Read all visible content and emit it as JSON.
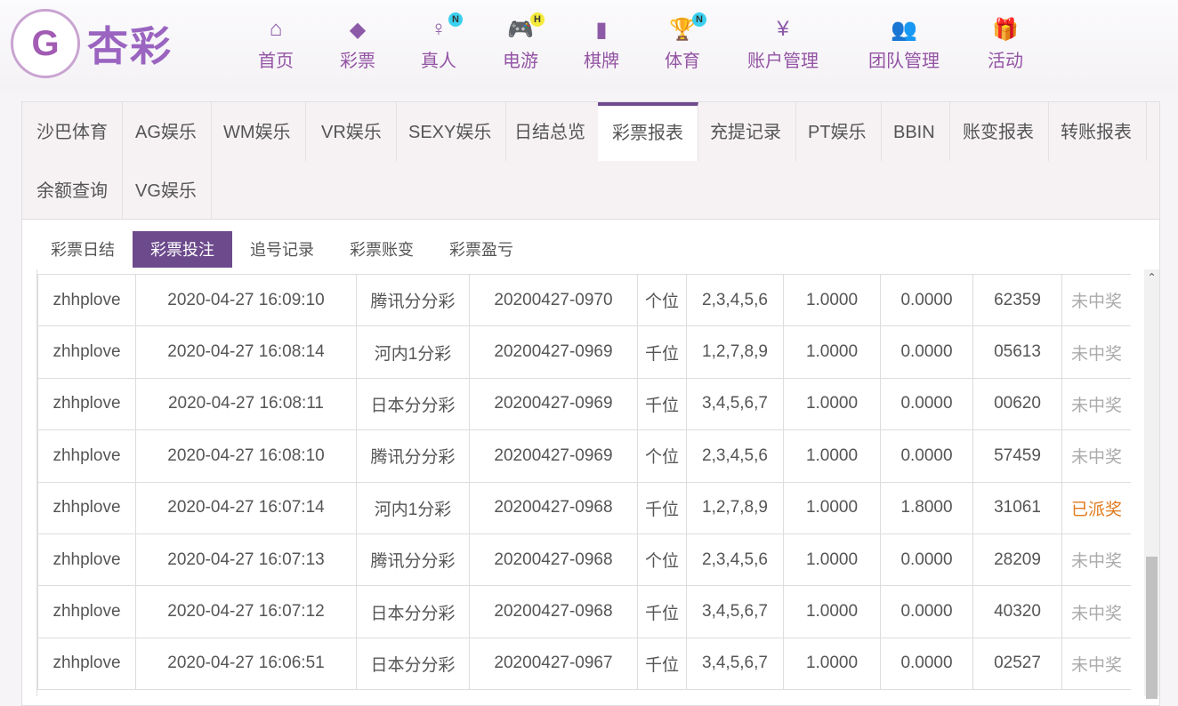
{
  "brand": {
    "name": "杏彩",
    "mark": "G"
  },
  "nav": [
    {
      "label": "首页",
      "icon": "home-icon",
      "glyph": "⌂"
    },
    {
      "label": "彩票",
      "icon": "ticket-icon",
      "glyph": "◆"
    },
    {
      "label": "真人",
      "icon": "live-dealer-icon",
      "glyph": "♀",
      "badge": "N",
      "badge_color": "#3ad0f0"
    },
    {
      "label": "电游",
      "icon": "gamepad-icon",
      "glyph": "🎮",
      "badge": "H",
      "badge_color": "#f4ea3a"
    },
    {
      "label": "棋牌",
      "icon": "cards-icon",
      "glyph": "▮"
    },
    {
      "label": "体育",
      "icon": "trophy-icon",
      "glyph": "🏆",
      "badge": "N",
      "badge_color": "#3ad0f0"
    },
    {
      "label": "账户管理",
      "icon": "yen-coin-icon",
      "glyph": "¥"
    },
    {
      "label": "团队管理",
      "icon": "team-icon",
      "glyph": "👥"
    },
    {
      "label": "活动",
      "icon": "gift-icon",
      "glyph": "🎁"
    }
  ],
  "tabs": [
    "沙巴体育",
    "AG娱乐",
    "WM娱乐",
    "VR娱乐",
    "SEXY娱乐",
    "日结总览",
    "彩票报表",
    "充提记录",
    "PT娱乐",
    "BBIN",
    "账变报表",
    "转账报表",
    "余额查询",
    "VG娱乐"
  ],
  "active_tab": "彩票报表",
  "subtabs": [
    "彩票日结",
    "彩票投注",
    "追号记录",
    "彩票账变",
    "彩票盈亏"
  ],
  "active_subtab": "彩票投注",
  "rows": [
    [
      "zhhplove",
      "2020-04-27 16:09:10",
      "腾讯分分彩",
      "20200427-0970",
      "个位",
      "2,3,4,5,6",
      "1.0000",
      "0.0000",
      "62359",
      "未中奖"
    ],
    [
      "zhhplove",
      "2020-04-27 16:08:14",
      "河内1分彩",
      "20200427-0969",
      "千位",
      "1,2,7,8,9",
      "1.0000",
      "0.0000",
      "05613",
      "未中奖"
    ],
    [
      "zhhplove",
      "2020-04-27 16:08:11",
      "日本分分彩",
      "20200427-0969",
      "千位",
      "3,4,5,6,7",
      "1.0000",
      "0.0000",
      "00620",
      "未中奖"
    ],
    [
      "zhhplove",
      "2020-04-27 16:08:10",
      "腾讯分分彩",
      "20200427-0969",
      "个位",
      "2,3,4,5,6",
      "1.0000",
      "0.0000",
      "57459",
      "未中奖"
    ],
    [
      "zhhplove",
      "2020-04-27 16:07:14",
      "河内1分彩",
      "20200427-0968",
      "千位",
      "1,2,7,8,9",
      "1.0000",
      "1.8000",
      "31061",
      "已派奖"
    ],
    [
      "zhhplove",
      "2020-04-27 16:07:13",
      "腾讯分分彩",
      "20200427-0968",
      "个位",
      "2,3,4,5,6",
      "1.0000",
      "0.0000",
      "28209",
      "未中奖"
    ],
    [
      "zhhplove",
      "2020-04-27 16:07:12",
      "日本分分彩",
      "20200427-0968",
      "千位",
      "3,4,5,6,7",
      "1.0000",
      "0.0000",
      "40320",
      "未中奖"
    ],
    [
      "zhhplove",
      "2020-04-27 16:06:51",
      "日本分分彩",
      "20200427-0967",
      "千位",
      "3,4,5,6,7",
      "1.0000",
      "0.0000",
      "02527",
      "未中奖"
    ]
  ]
}
